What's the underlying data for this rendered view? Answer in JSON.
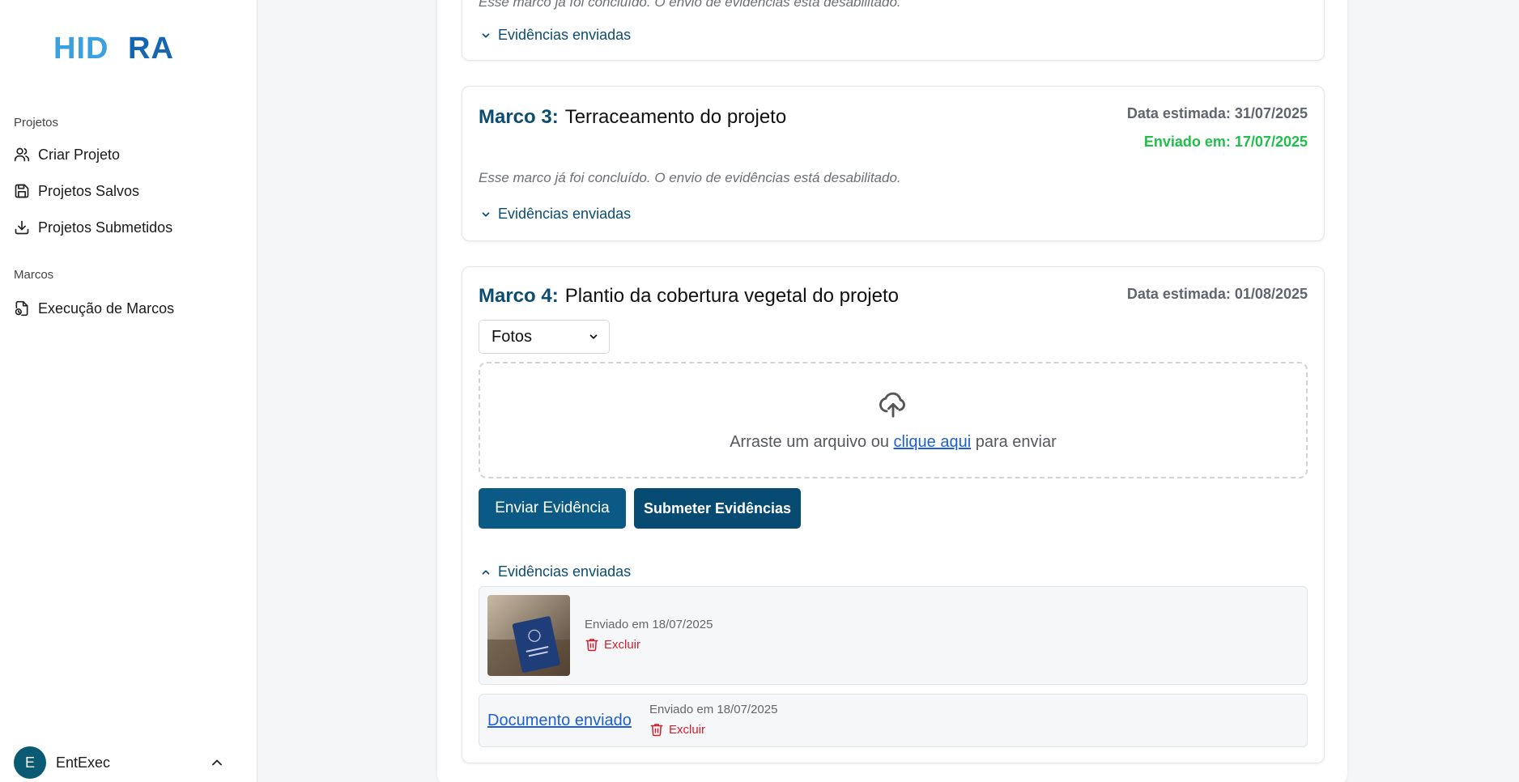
{
  "sidebar": {
    "logo_text": "HIDRA",
    "section_projects": "Projetos",
    "items_projects": [
      {
        "label": "Criar Projeto",
        "icon": "user-icon"
      },
      {
        "label": "Projetos Salvos",
        "icon": "save-icon"
      },
      {
        "label": "Projetos Submetidos",
        "icon": "download-icon"
      }
    ],
    "section_marcos": "Marcos",
    "items_marcos": [
      {
        "label": "Execução de Marcos",
        "icon": "file-exec-icon"
      }
    ],
    "user": {
      "initial": "E",
      "name": "EntExec"
    }
  },
  "cards": {
    "card1": {
      "note": "Esse marco já foi concluído. O envio de evidências está desabilitado.",
      "evidence_toggle": "Evidências enviadas"
    },
    "card2": {
      "marco_label": "Marco 3:",
      "title": "Terraceamento do projeto",
      "date_estimated": "Data estimada: 31/07/2025",
      "date_sent": "Enviado em: 17/07/2025",
      "note": "Esse marco já foi concluído. O envio de evidências está desabilitado.",
      "evidence_toggle": "Evidências enviadas"
    },
    "card3": {
      "marco_label": "Marco 4:",
      "title": "Plantio da cobertura vegetal do projeto",
      "date_estimated": "Data estimada: 01/08/2025",
      "select_value": "Fotos",
      "dropzone": {
        "prefix": "Arraste um arquivo ou ",
        "link": "clique aqui",
        "suffix": " para enviar"
      },
      "btn_send": "Enviar Evidência",
      "btn_submit": "Submeter Evidências",
      "evidence_toggle": "Evidências enviadas",
      "evidences": [
        {
          "sent_at": "Enviado em 18/07/2025",
          "delete_label": "Excluir"
        },
        {
          "doc_label": "Documento enviado",
          "sent_at": "Enviado em 18/07/2025",
          "delete_label": "Excluir"
        }
      ]
    }
  },
  "colors": {
    "brand_dark": "#0b4d72",
    "sent_green": "#1fbf49",
    "delete_red": "#d01e2c",
    "link_blue": "#1f5fd6",
    "logo_light_blue": "#3aa0e0"
  }
}
